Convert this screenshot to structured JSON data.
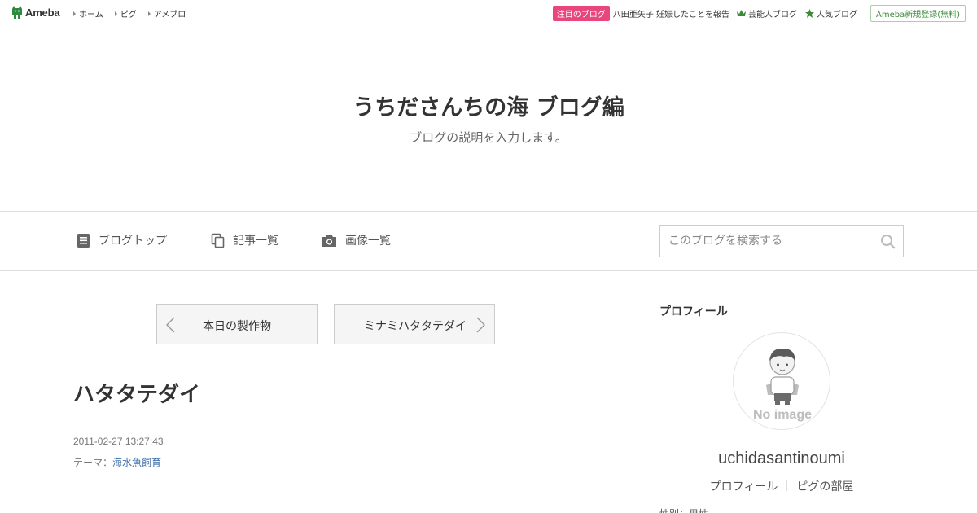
{
  "topbar": {
    "logo_text": "Ameba",
    "nav": [
      "ホーム",
      "ピグ",
      "アメブロ"
    ],
    "featured_badge": "注目のブログ",
    "featured_text": "八田亜矢子 妊娠したことを報告",
    "celebrity_blog": "芸能人ブログ",
    "popular_blog": "人気ブログ",
    "signup": "Ameba新規登録(無料)"
  },
  "header": {
    "title": "うちださんちの海 ブログ編",
    "description": "ブログの説明を入力します。"
  },
  "navbar": {
    "blog_top": "ブログトップ",
    "article_list": "記事一覧",
    "image_list": "画像一覧",
    "search_placeholder": "このブログを検索する"
  },
  "pager": {
    "prev_label": "本日の製作物",
    "next_label": "ミナミハタタテダイ"
  },
  "article": {
    "title": "ハタタテダイ",
    "datetime": "2011-02-27 13:27:43",
    "theme_label": "テーマ：",
    "theme_value": "海水魚飼育"
  },
  "sidebar": {
    "heading": "プロフィール",
    "avatar_text": "No image",
    "username": "uchidasantinoumi",
    "links": [
      "プロフィール",
      "ピグの部屋"
    ],
    "cut_text": "性別：男性"
  },
  "colors": {
    "badge": "#e8467c",
    "link": "#3e6fa8",
    "signup_green": "#3a8a3a"
  }
}
